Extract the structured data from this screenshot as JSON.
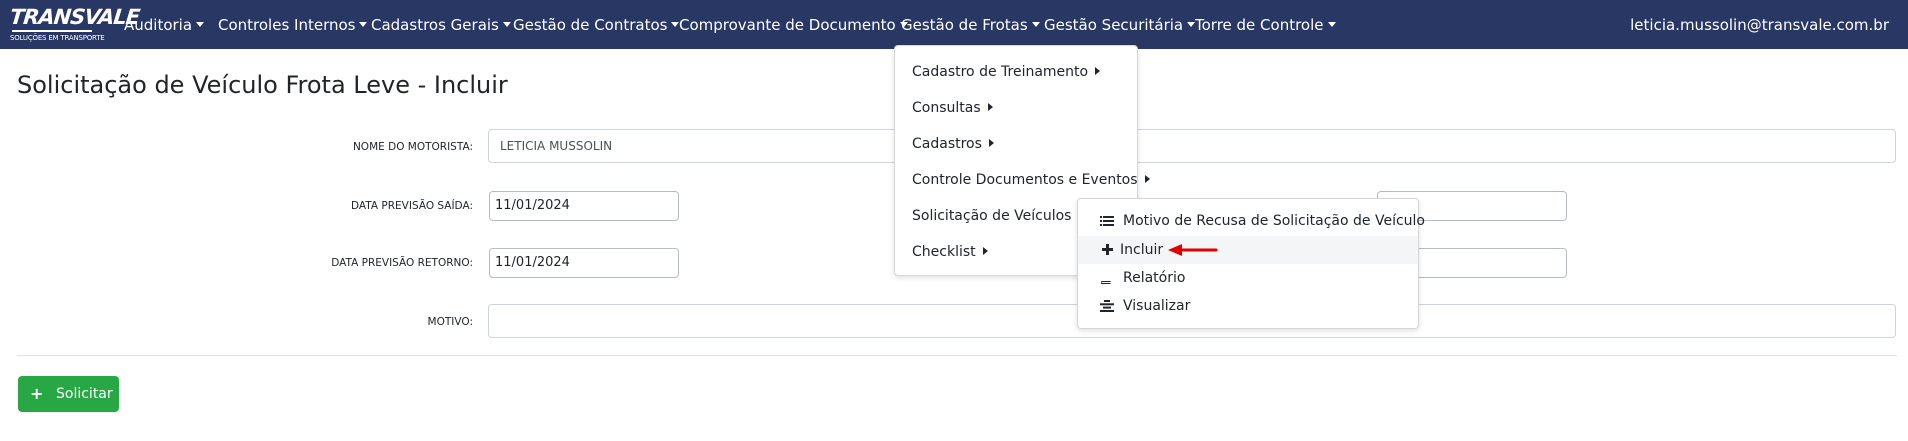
{
  "navbar": {
    "logo_text": "TRANSVALE",
    "logo_subtitle": "SOLUÇÕES EM TRANSPORTE",
    "menu": [
      {
        "label": "Auditoria"
      },
      {
        "label": "Controles Internos"
      },
      {
        "label": "Cadastros Gerais"
      },
      {
        "label": "Gestão de Contratos"
      },
      {
        "label": "Comprovante de Documento"
      },
      {
        "label": "Gestão de Frotas"
      },
      {
        "label": "Gestão Securitária"
      },
      {
        "label": "Torre de Controle"
      }
    ],
    "user_email": "leticia.mussolin@transvale.com.br"
  },
  "page": {
    "title": "Solicitação de Veículo Frota Leve - Incluir"
  },
  "form": {
    "driver_label": "NOME DO MOTORISTA:",
    "driver_value": "LETICIA MUSSOLIN",
    "departure_label": "DATA PREVISÃO SAÍDA:",
    "departure_value": "11/01/2024",
    "return_label": "DATA PREVISÃO RETORNO:",
    "return_value": "11/01/2024",
    "reason_label": "MOTIVO:",
    "reason_value": "",
    "submit_label": "Solicitar"
  },
  "fleet_dropdown": {
    "items": [
      {
        "label": "Cadastro de Treinamento"
      },
      {
        "label": "Consultas"
      },
      {
        "label": "Cadastros"
      },
      {
        "label": "Controle Documentos e Eventos"
      },
      {
        "label": "Solicitação de Veículos"
      },
      {
        "label": "Checklist"
      }
    ]
  },
  "vehicle_submenu": {
    "items": [
      {
        "label": "Motivo de Recusa de Solicitação de Veículo",
        "icon": "list-icon"
      },
      {
        "label": "Incluir",
        "icon": "plus-icon"
      },
      {
        "label": "Relatório",
        "icon": "book-icon"
      },
      {
        "label": "Visualizar",
        "icon": "align-center-icon"
      }
    ]
  },
  "colors": {
    "navbar": "#283763",
    "success": "#28a745",
    "annotation_arrow": "#e00000"
  }
}
